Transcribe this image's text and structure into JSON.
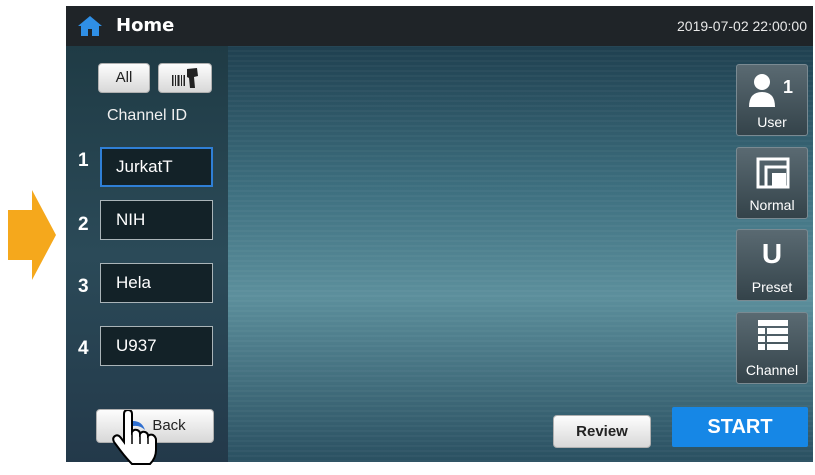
{
  "header": {
    "title": "Home",
    "datetime": "2019-07-02 22:00:00"
  },
  "sidebar": {
    "all_label": "All",
    "channel_id_label": "Channel ID",
    "channels": [
      {
        "number": "1",
        "value": "JurkatT"
      },
      {
        "number": "2",
        "value": "NIH"
      },
      {
        "number": "3",
        "value": "Hela"
      },
      {
        "number": "4",
        "value": "U937"
      }
    ],
    "back_label": "Back"
  },
  "right_panel": {
    "user_count": "1",
    "user_label": "User",
    "normal_label": "Normal",
    "preset_letter": "U",
    "preset_label": "Preset",
    "channel_label": "Channel"
  },
  "footer": {
    "review_label": "Review",
    "start_label": "START"
  },
  "colors": {
    "accent": "#1687e6",
    "arrow": "#f5a81c",
    "home_icon": "#2f8fe6"
  },
  "icons": [
    "home-icon",
    "barcode-scanner-icon",
    "back-arrow-icon",
    "hand-pointer-icon",
    "user-icon",
    "window-icon",
    "list-icon",
    "right-arrow-icon"
  ]
}
